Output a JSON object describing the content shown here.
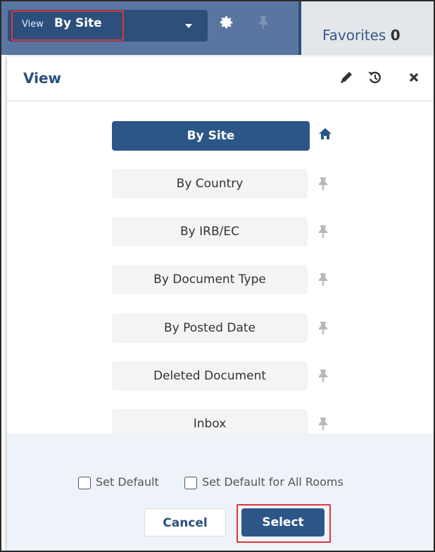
{
  "topbar": {
    "view_prefix": "View",
    "view_value": "By Site",
    "favorites_label": "Favorites",
    "favorites_count": "0"
  },
  "dialog": {
    "title": "View",
    "options": [
      {
        "label": "By Site",
        "selected": true,
        "icon": "home-icon"
      },
      {
        "label": "By Country",
        "selected": false,
        "icon": "pin-icon"
      },
      {
        "label": "By IRB/EC",
        "selected": false,
        "icon": "pin-icon"
      },
      {
        "label": "By Document Type",
        "selected": false,
        "icon": "pin-icon"
      },
      {
        "label": "By Posted Date",
        "selected": false,
        "icon": "pin-icon"
      },
      {
        "label": "Deleted Document",
        "selected": false,
        "icon": "pin-icon"
      },
      {
        "label": "Inbox",
        "selected": false,
        "icon": "pin-icon"
      }
    ],
    "set_default_label": "Set Default",
    "set_default_all_label": "Set Default for All Rooms",
    "cancel_label": "Cancel",
    "select_label": "Select"
  },
  "colors": {
    "primary": "#2c5688",
    "highlight": "#e0343b",
    "footer_bg": "#eef3f9"
  }
}
